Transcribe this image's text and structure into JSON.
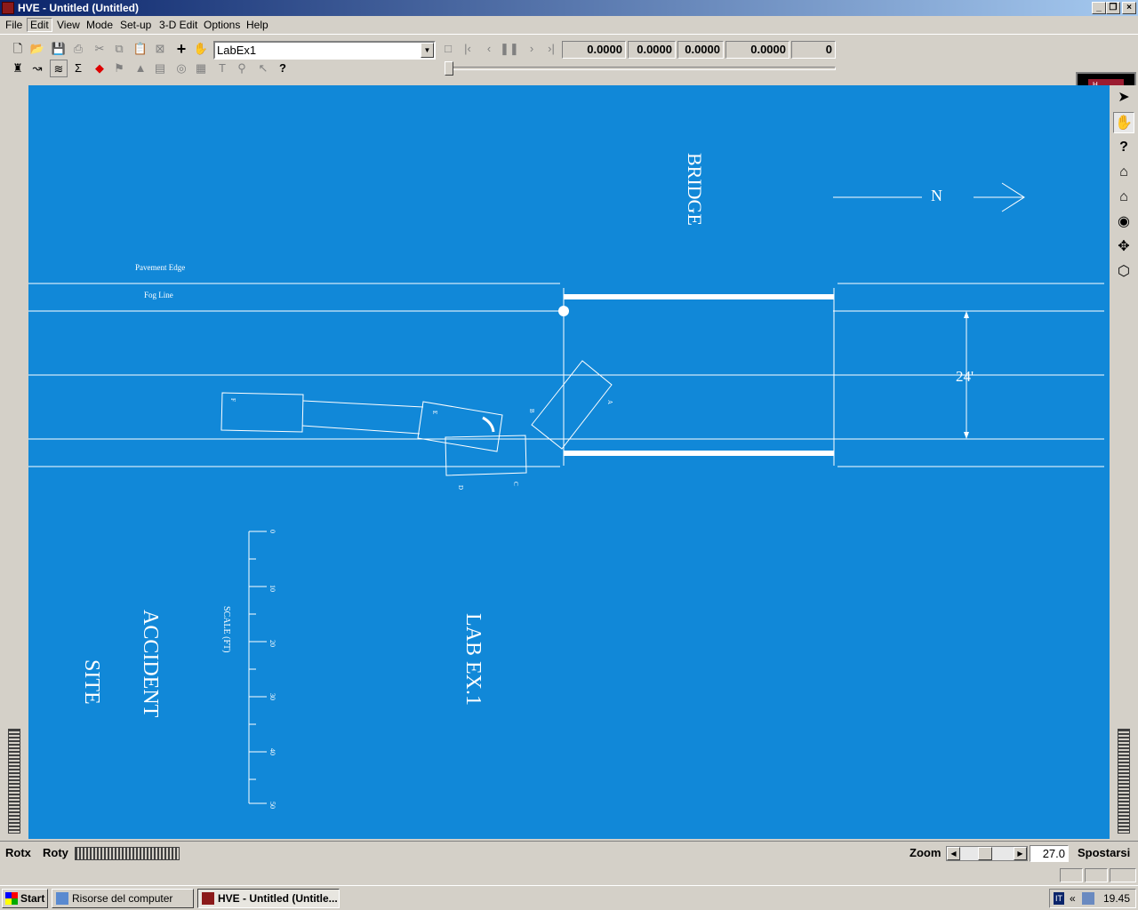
{
  "window": {
    "title": "HVE - Untitled (Untitled)",
    "min": "_",
    "restore": "❐",
    "close": "×"
  },
  "menu": [
    "File",
    "Edit",
    "View",
    "Mode",
    "Set-up",
    "3-D Edit",
    "Options",
    "Help"
  ],
  "toolbar": {
    "event_name": "LabEx1",
    "values": [
      "0.0000",
      "0.0000",
      "0.0000",
      "0.0000",
      "0"
    ]
  },
  "logo": {
    "letters": [
      "H",
      "V",
      "E"
    ]
  },
  "drawing": {
    "bridge_label": "BRIDGE",
    "north_label": "N",
    "pavement_edge": "Pavement Edge",
    "fog_line": "Fog Line",
    "width_dim": "24'",
    "accident_label": "ACCIDENT",
    "site_label": "SITE",
    "lab_label": "LAB EX.1",
    "scale_label": "SCALE (FT)",
    "scale_ticks": [
      "0",
      "10",
      "20",
      "30",
      "40",
      "50"
    ],
    "vehicle_letters": [
      "A",
      "B",
      "C",
      "D",
      "E",
      "F"
    ]
  },
  "status": {
    "rotx": "Rotx",
    "roty": "Roty",
    "zoom_label": "Zoom",
    "zoom_value": "27.0",
    "mode": "Spostarsi"
  },
  "taskbar": {
    "start": "Start",
    "tasks": [
      "Risorse del computer",
      "HVE - Untitled (Untitle..."
    ],
    "tray_lang": "IT",
    "clock": "19.45"
  },
  "colors": {
    "canvas": "#1188d8",
    "line": "#ffffff"
  }
}
